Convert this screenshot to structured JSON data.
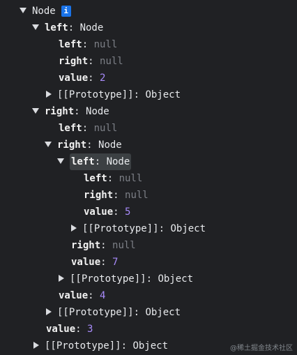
{
  "root": {
    "label": "Node",
    "info": "i"
  },
  "rows": {
    "r1": {
      "key": "left",
      "value": "Node"
    },
    "r2": {
      "key": "left",
      "value": "null"
    },
    "r3": {
      "key": "right",
      "value": "null"
    },
    "r4": {
      "key": "value",
      "value": "2"
    },
    "r5": {
      "key": "[[Prototype]]",
      "value": "Object"
    },
    "r6": {
      "key": "right",
      "value": "Node"
    },
    "r7": {
      "key": "left",
      "value": "null"
    },
    "r8": {
      "key": "right",
      "value": "Node"
    },
    "r9": {
      "key": "left",
      "value": "Node"
    },
    "r10": {
      "key": "left",
      "value": "null"
    },
    "r11": {
      "key": "right",
      "value": "null"
    },
    "r12": {
      "key": "value",
      "value": "5"
    },
    "r13": {
      "key": "[[Prototype]]",
      "value": "Object"
    },
    "r14": {
      "key": "right",
      "value": "null"
    },
    "r15": {
      "key": "value",
      "value": "7"
    },
    "r16": {
      "key": "[[Prototype]]",
      "value": "Object"
    },
    "r17": {
      "key": "value",
      "value": "4"
    },
    "r18": {
      "key": "[[Prototype]]",
      "value": "Object"
    },
    "r19": {
      "key": "value",
      "value": "3"
    },
    "r20": {
      "key": "[[Prototype]]",
      "value": "Object"
    }
  },
  "colors": {
    "background": "#202124",
    "key": "#f2f2f2",
    "null": "#7d8087",
    "number": "#a88bfa",
    "badge": "#1a73e8"
  },
  "watermark": "@稀土掘金技术社区"
}
